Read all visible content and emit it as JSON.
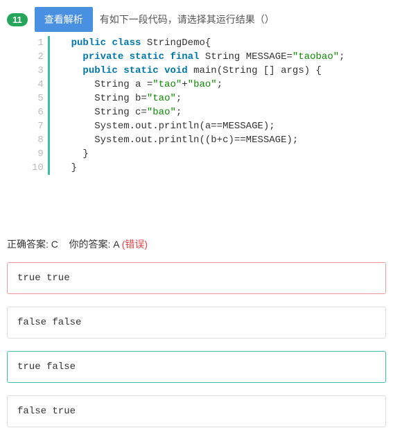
{
  "header": {
    "number": "11",
    "analysis_btn": "查看解析",
    "prompt": "有如下一段代码，请选择其运行结果（）"
  },
  "code": {
    "lines": [
      {
        "n": "1",
        "indent": 2,
        "tokens": [
          {
            "t": "public",
            "k": true
          },
          {
            "t": " "
          },
          {
            "t": "class",
            "k": true
          },
          {
            "t": " StringDemo{"
          }
        ]
      },
      {
        "n": "2",
        "indent": 4,
        "tokens": [
          {
            "t": "private",
            "k": true
          },
          {
            "t": " "
          },
          {
            "t": "static",
            "k": true
          },
          {
            "t": " "
          },
          {
            "t": "final",
            "k": true
          },
          {
            "t": " String MESSAGE="
          },
          {
            "t": "\"taobao\"",
            "s": true
          },
          {
            "t": ";"
          }
        ]
      },
      {
        "n": "3",
        "indent": 4,
        "tokens": [
          {
            "t": "public",
            "k": true
          },
          {
            "t": " "
          },
          {
            "t": "static",
            "k": true
          },
          {
            "t": " "
          },
          {
            "t": "void",
            "k": true
          },
          {
            "t": " main(String [] args) {"
          }
        ]
      },
      {
        "n": "4",
        "indent": 6,
        "tokens": [
          {
            "t": "String a ="
          },
          {
            "t": "\"tao\"",
            "s": true
          },
          {
            "t": "+"
          },
          {
            "t": "\"bao\"",
            "s": true
          },
          {
            "t": ";"
          }
        ]
      },
      {
        "n": "5",
        "indent": 6,
        "tokens": [
          {
            "t": "String b="
          },
          {
            "t": "\"tao\"",
            "s": true
          },
          {
            "t": ";"
          }
        ]
      },
      {
        "n": "6",
        "indent": 6,
        "tokens": [
          {
            "t": "String c="
          },
          {
            "t": "\"bao\"",
            "s": true
          },
          {
            "t": ";"
          }
        ]
      },
      {
        "n": "7",
        "indent": 6,
        "tokens": [
          {
            "t": "System.out.println(a==MESSAGE);"
          }
        ]
      },
      {
        "n": "8",
        "indent": 6,
        "tokens": [
          {
            "t": "System.out.println((b+c)==MESSAGE);"
          }
        ]
      },
      {
        "n": "9",
        "indent": 4,
        "tokens": [
          {
            "t": "}"
          }
        ]
      },
      {
        "n": "10",
        "indent": 2,
        "tokens": [
          {
            "t": "}"
          }
        ]
      }
    ]
  },
  "answer": {
    "correct_label": "正确答案: C",
    "your_label": "你的答案: A",
    "wrong_text": "(错误)"
  },
  "options": [
    {
      "text": "true true",
      "state": "selected"
    },
    {
      "text": "false false",
      "state": ""
    },
    {
      "text": "true false",
      "state": "correct"
    },
    {
      "text": "false true",
      "state": ""
    }
  ]
}
